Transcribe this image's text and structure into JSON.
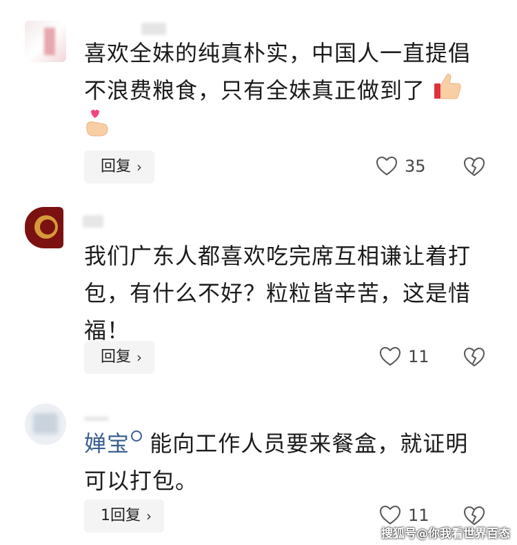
{
  "comments": [
    {
      "text": "喜欢全妹的纯真朴实，中国人一直提倡不浪费粮食，只有全妹真正做到了",
      "reply_label": "回复",
      "likes": "35"
    },
    {
      "text": "我们广东人都喜欢吃完席互相谦让着打包，有什么不好？粒粒皆辛苦，这是惜福！",
      "reply_label": "回复",
      "likes": "11"
    },
    {
      "mention": "婵宝",
      "text": "能向工作人员要来餐盒，就证明可以打包。",
      "reply_label": "1回复",
      "likes": "11"
    }
  ],
  "watermark": "搜狐号@你我看世界百态",
  "colors": {
    "mention": "#3a5f8f",
    "button_bg": "#f4f4f4"
  }
}
